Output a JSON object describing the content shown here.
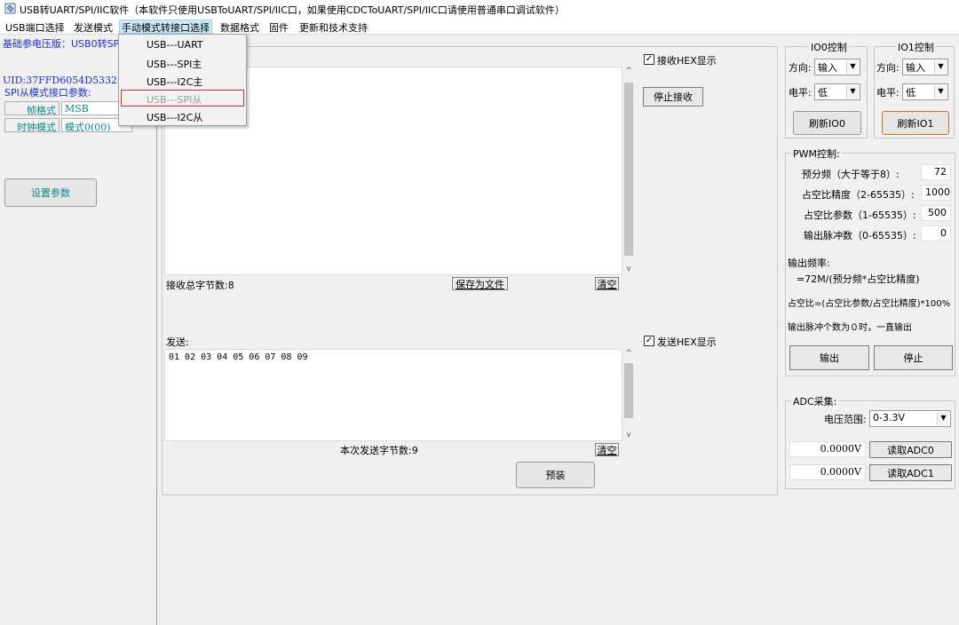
{
  "window": {
    "title": "USB转UART/SPI/IIC软件（本软件只使用USBToUART/SPI/IIC口，如果使用CDCToUART/SPI/IIC口请使用普通串口调试软件）"
  },
  "menu": {
    "items": [
      "USB端口选择",
      "发送模式",
      "手动模式转接口选择",
      "数据格式",
      "固件",
      "更新和技术支持"
    ],
    "dropdown": [
      "USB---UART",
      "USB---SPI主",
      "USB---I2C主",
      "USB---SPI从",
      "USB---I2C从"
    ]
  },
  "left": {
    "voltage_line": "基础参电压版：USB0转SPI",
    "uid": "UID:37FFD6054D533236540",
    "spi_params_title": "SPI从模式接口参数:",
    "frame_label": "帧格式",
    "frame_value": "MSB",
    "clock_label": "时钟模式",
    "clock_value": "模式0(00)",
    "set_params_button": "设置参数"
  },
  "receive": {
    "content": "      36 37 38",
    "hex_checkbox_label": "接收HEX显示",
    "hex_checked": true,
    "stop_button": "停止接收",
    "total_bytes": "接收总字节数:8",
    "save_button": "保存为文件",
    "clear_button": "清空"
  },
  "send": {
    "label": "发送:",
    "content": "01 02 03 04 05 06 07 08 09",
    "hex_checkbox_label": "发送HEX显示",
    "hex_checked": true,
    "sent_bytes": "本次发送字节数:9",
    "clear_button": "清空",
    "preload_button": "预装"
  },
  "io0": {
    "title": "IO0控制",
    "dir_label": "方向:",
    "dir_value": "输入",
    "level_label": "电平:",
    "level_value": "低",
    "refresh_button": "刷新IO0"
  },
  "io1": {
    "title": "IO1控制",
    "dir_label": "方向:",
    "dir_value": "输入",
    "level_label": "电平:",
    "level_value": "低",
    "refresh_button": "刷新IO1"
  },
  "pwm": {
    "title": "PWM控制:",
    "prescaler_label": "预分频（大于等于8）:",
    "prescaler_value": "72",
    "duty_precision_label": "占空比精度（2-65535）:",
    "duty_precision_value": "1000",
    "duty_param_label": "占空比参数（1-65535）:",
    "duty_param_value": "500",
    "pulse_count_label": "输出脉冲数（0-65535）:",
    "pulse_count_value": "0",
    "freq_title": "输出频率:",
    "freq_formula": "=72M/(预分频*占空比精度)",
    "duty_formula": "占空比=(占空比参数/占空比精度)*100%",
    "pulse_note": "输出脉冲个数为０时，一直输出",
    "output_button": "输出",
    "stop_button": "停止"
  },
  "adc": {
    "title": "ADC采集:",
    "range_label": "电压范围:",
    "range_value": "0-3.3V",
    "adc0_value": "0.0000V",
    "adc0_button": "读取ADC0",
    "adc1_value": "0.0000V",
    "adc1_button": "读取ADC1"
  }
}
